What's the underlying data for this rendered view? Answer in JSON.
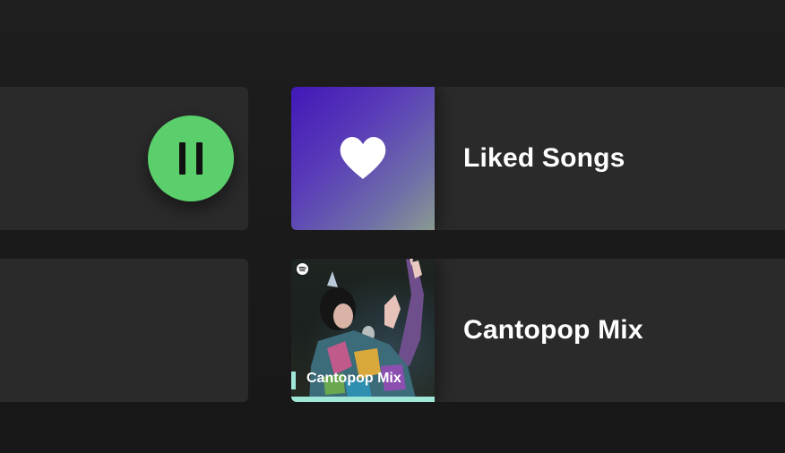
{
  "shortcuts": [
    {
      "title": "",
      "playing": true
    },
    {
      "title": "Liked Songs",
      "art_icon": "heart-icon",
      "art_colors": [
        "#4217b8",
        "#8a9a90"
      ]
    },
    {
      "title": "",
      "playing": false
    },
    {
      "title": "Cantopop Mix",
      "art_label": "Cantopop Mix",
      "art_badge_icon": "spotify-logo-icon",
      "accent_color": "#9fe7d7"
    }
  ],
  "colors": {
    "play_button": "#5acf6b",
    "card_background": "#2a2a2a",
    "page_background": "#1a1a1a"
  },
  "controls": {
    "pause_icon": "pause-icon"
  }
}
